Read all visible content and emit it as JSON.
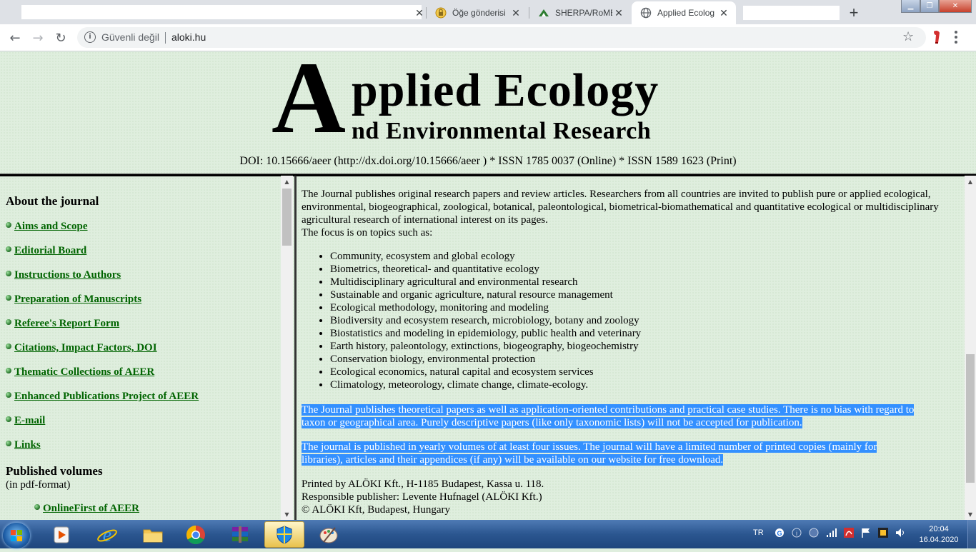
{
  "browser": {
    "tabs": [
      {
        "title": "",
        "favicon": "redacted"
      },
      {
        "title": "Öğe gönderisi",
        "favicon": "lock-badge-icon"
      },
      {
        "title": "SHERPA/RoMEO",
        "favicon": "sherpa-icon"
      },
      {
        "title": "Applied Ecolog",
        "favicon": "globe-icon"
      },
      {
        "title": "",
        "favicon": "redacted"
      }
    ],
    "security_label": "Güvenli değil",
    "url": "aloki.hu",
    "window_controls": {
      "minimize": "▁",
      "maximize": "❐",
      "close": "✕"
    }
  },
  "header": {
    "logo_big_letter": "A",
    "logo_line1": "pplied Ecology",
    "logo_line2": "nd Environmental Research",
    "doi_line": "DOI: 10.15666/aeer (http://dx.doi.org/10.15666/aeer ) * ISSN 1785 0037 (Online) * ISSN 1589 1623 (Print)"
  },
  "sidebar": {
    "about_heading": "About the journal",
    "links": [
      "Aims and Scope",
      "Editorial Board",
      "Instructions to Authors",
      "Preparation of Manuscripts",
      "Referee's Report Form",
      "Citations, Impact Factors, DOI",
      "Thematic Collections of AEER",
      "Enhanced Publications Project of AEER",
      "E-mail",
      "Links"
    ],
    "volumes_heading": "Published volumes",
    "volumes_sub": "(in pdf-format)",
    "volume_links": [
      "OnlineFirst of AEER"
    ]
  },
  "main": {
    "intro": "The Journal publishes original research papers and review articles. Researchers from all countries are invited to publish pure or applied ecological, environmental, biogeographical, zoological, botanical, paleontological, biometrical-biomathematical and quantitative ecological or multidisciplinary agricultural research of international interest on its pages.",
    "focus_label": "The focus is on topics such as:",
    "topics": [
      "Community, ecosystem and global ecology",
      "Biometrics, theoretical- and quantitative ecology",
      "Multidisciplinary agricultural and environmental research",
      "Sustainable and organic agriculture, natural resource management",
      "Ecological methodology, monitoring and modeling",
      "Biodiversity and ecosystem research, microbiology, botany and zoology",
      "Biostatistics and modeling in epidemiology, public health and veterinary",
      "Earth history, paleontology, extinctions, biogeography, biogeochemistry",
      "Conservation biology, environmental protection",
      "Ecological economics, natural capital and ecosystem services",
      "Climatology, meteorology, climate change, climate-ecology."
    ],
    "para_theoretical_1": "The Journal publishes theoretical papers as well as application-oriented contributions and practical case studies. There is no bias with regard to",
    "para_theoretical_2": "taxon or geographical area. Purely descriptive papers (like only taxonomic lists) will not be accepted for publication.",
    "para_published_1": "The journal is published in yearly volumes of at least four issues. The journal will have a limited number of printed copies (mainly for",
    "para_published_2": "libraries), articles and their appendices (if any) will be available on our website for free download.",
    "printed_by": "Printed by ALÖKI Kft., H-1185 Budapest, Kassa u. 118.",
    "publisher": "Responsible publisher: Levente Hufnagel (ALÖKI Kft.)",
    "copyright": "© ALÖKI Kft, Budapest, Hungary"
  },
  "taskbar": {
    "language": "TR",
    "time": "20:04",
    "date": "16.04.2020"
  },
  "colors": {
    "page_bg": "#dfeede",
    "link": "#006400",
    "selection": "#3390ff"
  }
}
